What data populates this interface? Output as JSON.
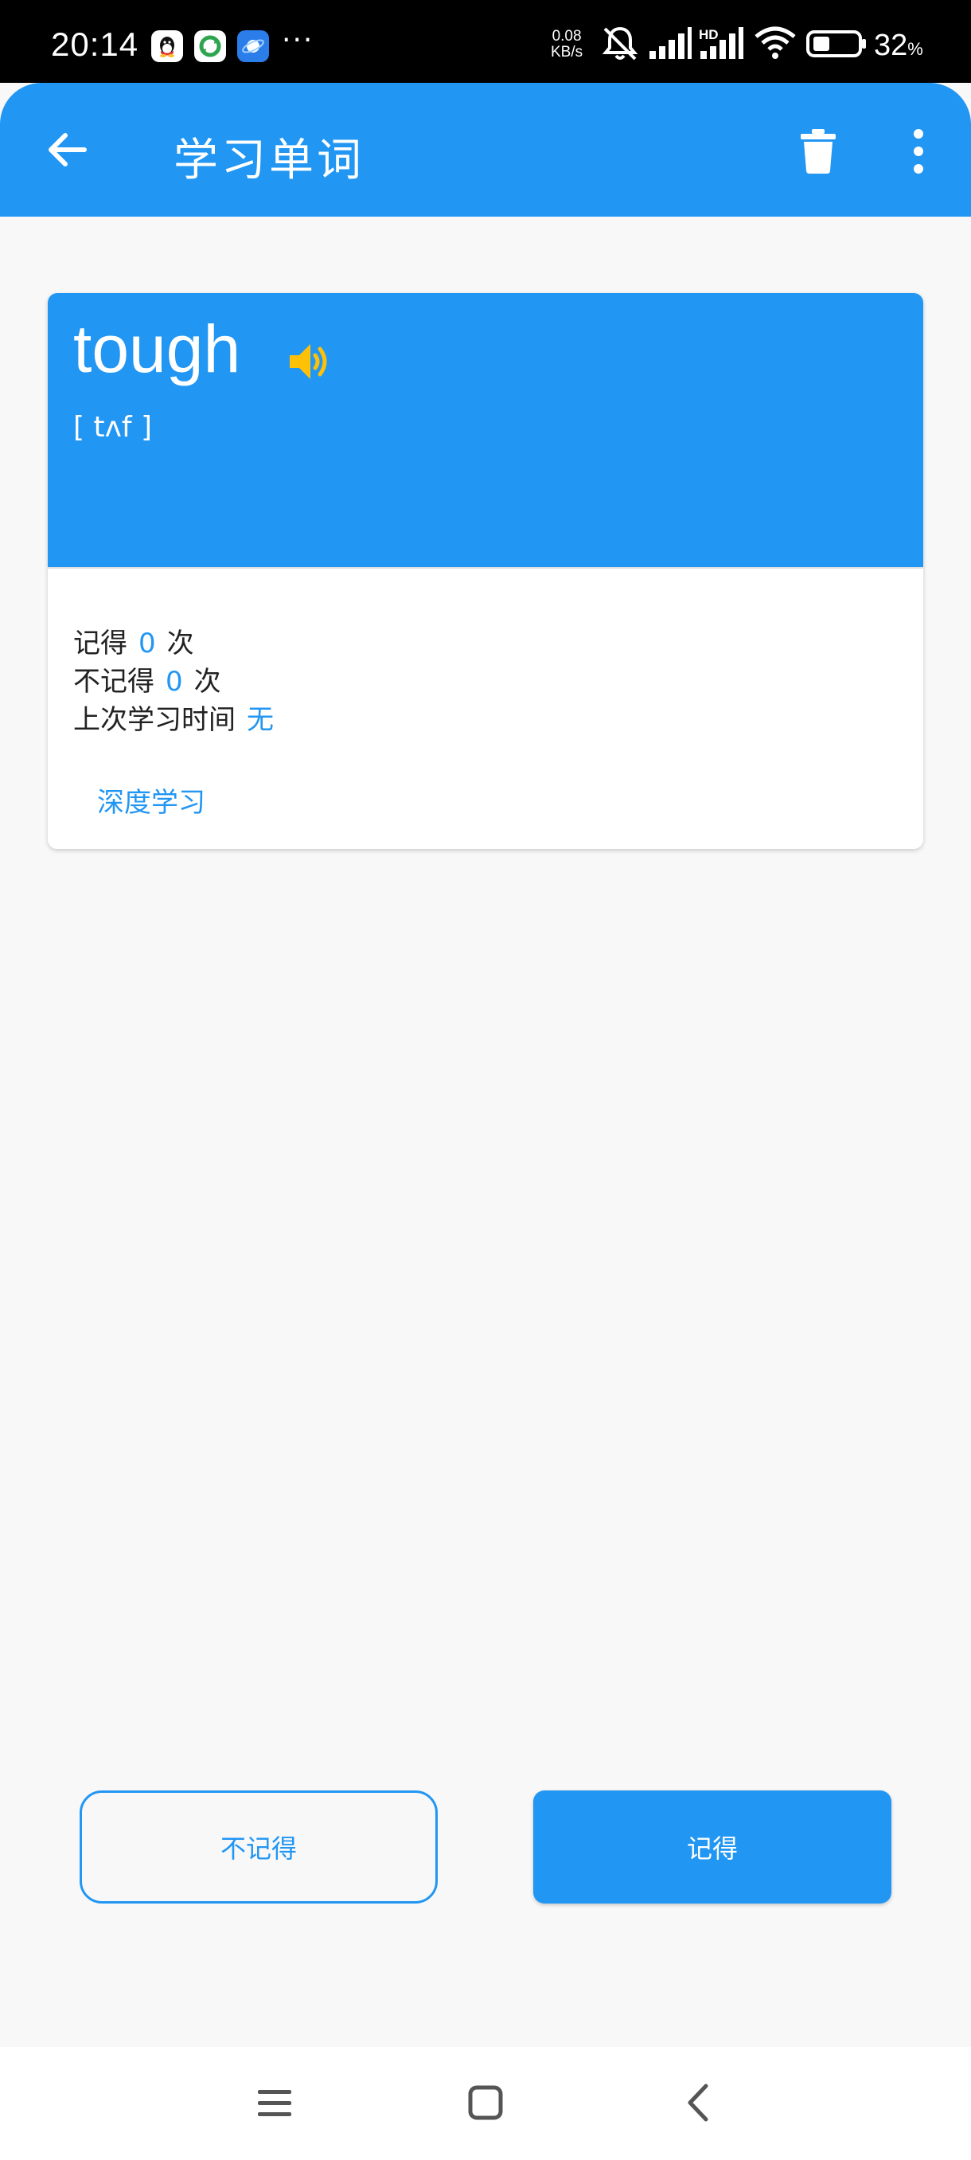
{
  "status_bar": {
    "time": "20:14",
    "more_dots": "···",
    "net_speed_value": "0.08",
    "net_speed_unit": "KB/s",
    "network_type": "HD",
    "battery_percent": "32",
    "battery_unit": "%",
    "icons": [
      "qq-icon",
      "sync-icon",
      "planet-icon",
      "mute-bell-icon",
      "signal-icon",
      "signal-hd-icon",
      "wifi-icon",
      "battery-icon"
    ]
  },
  "app_bar": {
    "title": "学习单词",
    "icons": [
      "back-arrow-icon",
      "trash-icon",
      "more-vert-icon"
    ]
  },
  "word_card": {
    "word": "tough",
    "phonetic": "[ tʌf ]",
    "speaker_icon": "speaker-icon",
    "stats": {
      "remember_label": "记得",
      "remember_count": "0",
      "remember_unit": "次",
      "forget_label": "不记得",
      "forget_count": "0",
      "forget_unit": "次",
      "last_time_label": "上次学习时间",
      "last_time_value": "无"
    },
    "deep_study_label": "深度学习"
  },
  "actions": {
    "forget_label": "不记得",
    "remember_label": "记得"
  },
  "nav_bar": {
    "icons": [
      "menu-icon",
      "home-square-icon",
      "back-chevron-icon"
    ]
  },
  "colors": {
    "primary": "#2196f3",
    "accent_speaker": "#ffc107",
    "background": "#f8f8f8"
  }
}
